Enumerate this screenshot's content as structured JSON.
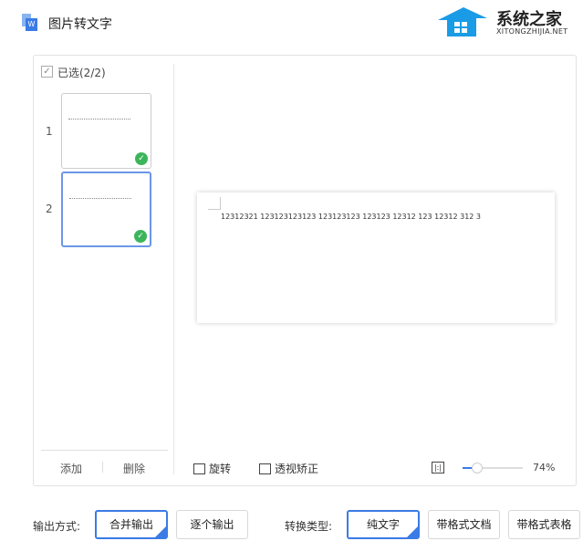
{
  "app": {
    "title": "图片转文字",
    "logo_text": "系统之家",
    "logo_sub": "XITONGZHIJIA.NET"
  },
  "sidebar": {
    "select_all": "已选(2/2)",
    "thumbs": [
      {
        "num": "1"
      },
      {
        "num": "2"
      }
    ],
    "add": "添加",
    "delete": "删除"
  },
  "preview": {
    "text": "12312321 123123123123 123123123 123123 12312 123 12312 312 3"
  },
  "toolbar": {
    "rotate": "旋转",
    "perspective": "透视矫正",
    "zoom": "74%",
    "zoom_value": 74
  },
  "footer": {
    "output_label": "输出方式:",
    "merge": "合并输出",
    "each": "逐个输出",
    "type_label": "转换类型:",
    "plain": "纯文字",
    "formatted_doc": "带格式文档",
    "formatted_table": "带格式表格"
  }
}
